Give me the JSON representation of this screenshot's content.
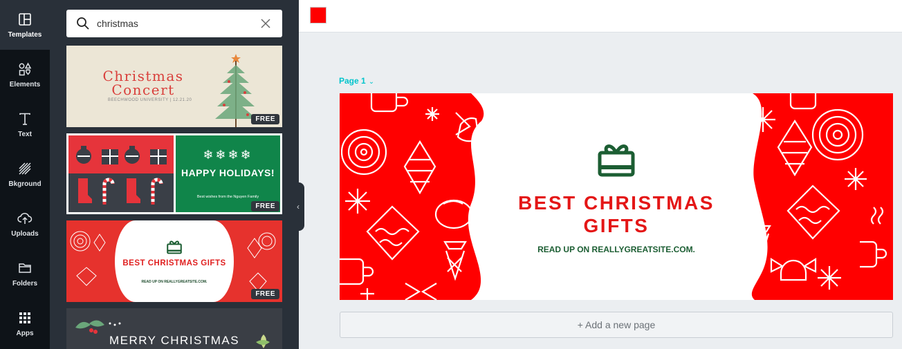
{
  "rail": {
    "items": [
      {
        "label": "Templates",
        "icon": "templates-icon"
      },
      {
        "label": "Elements",
        "icon": "elements-icon"
      },
      {
        "label": "Text",
        "icon": "text-icon"
      },
      {
        "label": "Bkground",
        "icon": "background-icon"
      },
      {
        "label": "Uploads",
        "icon": "uploads-icon"
      },
      {
        "label": "Folders",
        "icon": "folders-icon"
      },
      {
        "label": "Apps",
        "icon": "apps-icon"
      }
    ]
  },
  "search": {
    "value": "christmas",
    "icon": "search-icon",
    "clear_icon": "close-icon"
  },
  "templates": [
    {
      "title": "Christmas Concert",
      "subtitle": "BEECHWOOD UNIVERSITY | 12.21.20",
      "badge": "FREE"
    },
    {
      "title": "HAPPY HOLIDAYS!",
      "subtitle": "Best wishes from the Nguyen Family",
      "badge": "FREE"
    },
    {
      "title": "BEST CHRISTMAS GIFTS",
      "subtitle": "READ UP ON REALLYGREATSITE.COM.",
      "badge": "FREE"
    },
    {
      "title": "MERRY CHRISTMAS"
    }
  ],
  "editor": {
    "color_swatch": "#ff0000",
    "page_label": "Page 1",
    "page_chevron": "⌄",
    "design": {
      "title": "BEST CHRISTMAS GIFTS",
      "subtitle": "READ UP ON REALLYGREATSITE.COM."
    },
    "add_page": "+ Add a new page"
  },
  "collapse": "‹",
  "colors": {
    "accent": "#00c4cc",
    "brand_red": "#ff0000",
    "green": "#1c5e33",
    "panel": "#293039",
    "rail": "#0e1318"
  }
}
